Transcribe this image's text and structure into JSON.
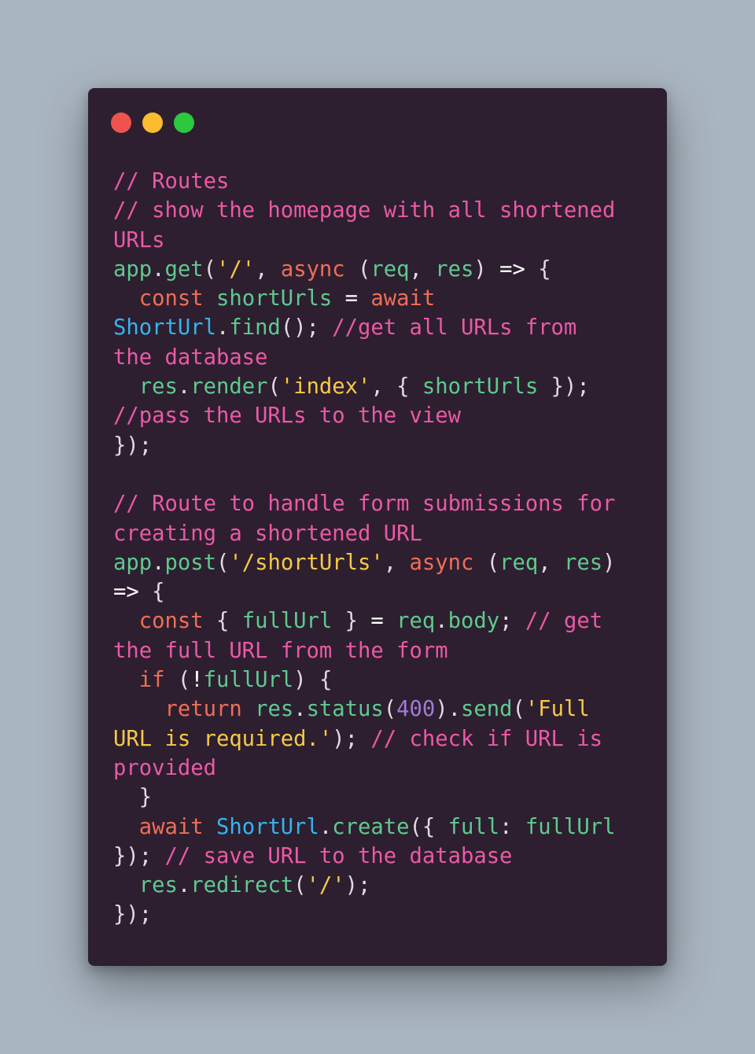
{
  "window": {
    "controls": {
      "close_color": "#f0534d",
      "minimize_color": "#fbbc2e",
      "maximize_color": "#2bc840"
    }
  },
  "colors": {
    "background": "#a9b5c0",
    "window": "#2d1f2f",
    "comment": "#eb59a6",
    "keyword": "#ef6e56",
    "function": "#5fc98f",
    "string": "#f7c948",
    "class": "#33b5f0",
    "number": "#a07ad6",
    "punctuation": "#e3d8e3"
  },
  "code": {
    "lines": [
      [
        [
          "comment",
          "// Routes"
        ]
      ],
      [
        [
          "comment",
          "// show the homepage with all shortened"
        ]
      ],
      [
        [
          "comment",
          "URLs"
        ]
      ],
      [
        [
          "fn",
          "app"
        ],
        [
          "punct",
          "."
        ],
        [
          "fn",
          "get"
        ],
        [
          "punct",
          "("
        ],
        [
          "string",
          "'/'"
        ],
        [
          "punct",
          ", "
        ],
        [
          "keyword",
          "async"
        ],
        [
          "punct",
          " ("
        ],
        [
          "fn",
          "req"
        ],
        [
          "punct",
          ", "
        ],
        [
          "fn",
          "res"
        ],
        [
          "punct",
          ") "
        ],
        [
          "op",
          "=>"
        ],
        [
          "punct",
          " {"
        ]
      ],
      [
        [
          "punct",
          "  "
        ],
        [
          "keyword",
          "const"
        ],
        [
          "punct",
          " "
        ],
        [
          "fn",
          "shortUrls"
        ],
        [
          "punct",
          " "
        ],
        [
          "op",
          "="
        ],
        [
          "punct",
          " "
        ],
        [
          "keyword",
          "await"
        ]
      ],
      [
        [
          "class",
          "ShortUrl"
        ],
        [
          "punct",
          "."
        ],
        [
          "fn",
          "find"
        ],
        [
          "punct",
          "(); "
        ],
        [
          "comment",
          "//get all URLs from"
        ]
      ],
      [
        [
          "comment",
          "the database"
        ]
      ],
      [
        [
          "punct",
          "  "
        ],
        [
          "fn",
          "res"
        ],
        [
          "punct",
          "."
        ],
        [
          "fn",
          "render"
        ],
        [
          "punct",
          "("
        ],
        [
          "string",
          "'index'"
        ],
        [
          "punct",
          ", { "
        ],
        [
          "fn",
          "shortUrls"
        ],
        [
          "punct",
          " });"
        ]
      ],
      [
        [
          "comment",
          "//pass the URLs to the view"
        ]
      ],
      [
        [
          "punct",
          "});"
        ]
      ],
      [],
      [
        [
          "comment",
          "// Route to handle form submissions for"
        ]
      ],
      [
        [
          "comment",
          "creating a shortened URL"
        ]
      ],
      [
        [
          "fn",
          "app"
        ],
        [
          "punct",
          "."
        ],
        [
          "fn",
          "post"
        ],
        [
          "punct",
          "("
        ],
        [
          "string",
          "'/shortUrls'"
        ],
        [
          "punct",
          ", "
        ],
        [
          "keyword",
          "async"
        ],
        [
          "punct",
          " ("
        ],
        [
          "fn",
          "req"
        ],
        [
          "punct",
          ", "
        ],
        [
          "fn",
          "res"
        ],
        [
          "punct",
          ")"
        ]
      ],
      [
        [
          "op",
          "=>"
        ],
        [
          "punct",
          " {"
        ]
      ],
      [
        [
          "punct",
          "  "
        ],
        [
          "keyword",
          "const"
        ],
        [
          "punct",
          " { "
        ],
        [
          "fn",
          "fullUrl"
        ],
        [
          "punct",
          " } "
        ],
        [
          "op",
          "="
        ],
        [
          "punct",
          " "
        ],
        [
          "fn",
          "req"
        ],
        [
          "punct",
          "."
        ],
        [
          "fn",
          "body"
        ],
        [
          "punct",
          "; "
        ],
        [
          "comment",
          "// get"
        ]
      ],
      [
        [
          "comment",
          "the full URL from the form"
        ]
      ],
      [
        [
          "punct",
          "  "
        ],
        [
          "keyword",
          "if"
        ],
        [
          "punct",
          " ("
        ],
        [
          "op",
          "!"
        ],
        [
          "fn",
          "fullUrl"
        ],
        [
          "punct",
          ") {"
        ]
      ],
      [
        [
          "punct",
          "    "
        ],
        [
          "keyword",
          "return"
        ],
        [
          "punct",
          " "
        ],
        [
          "fn",
          "res"
        ],
        [
          "punct",
          "."
        ],
        [
          "fn",
          "status"
        ],
        [
          "punct",
          "("
        ],
        [
          "number",
          "400"
        ],
        [
          "punct",
          ")."
        ],
        [
          "fn",
          "send"
        ],
        [
          "punct",
          "("
        ],
        [
          "string",
          "'Full"
        ]
      ],
      [
        [
          "string",
          "URL is required.'"
        ],
        [
          "punct",
          "); "
        ],
        [
          "comment",
          "// check if URL is"
        ]
      ],
      [
        [
          "comment",
          "provided"
        ]
      ],
      [
        [
          "punct",
          "  }"
        ]
      ],
      [
        [
          "punct",
          "  "
        ],
        [
          "keyword",
          "await"
        ],
        [
          "punct",
          " "
        ],
        [
          "class",
          "ShortUrl"
        ],
        [
          "punct",
          "."
        ],
        [
          "fn",
          "create"
        ],
        [
          "punct",
          "({ "
        ],
        [
          "fn",
          "full"
        ],
        [
          "punct",
          ": "
        ],
        [
          "fn",
          "fullUrl"
        ]
      ],
      [
        [
          "punct",
          "}); "
        ],
        [
          "comment",
          "// save URL to the database"
        ]
      ],
      [
        [
          "punct",
          "  "
        ],
        [
          "fn",
          "res"
        ],
        [
          "punct",
          "."
        ],
        [
          "fn",
          "redirect"
        ],
        [
          "punct",
          "("
        ],
        [
          "string",
          "'/'"
        ],
        [
          "punct",
          ");"
        ]
      ],
      [
        [
          "punct",
          "});"
        ]
      ]
    ]
  }
}
